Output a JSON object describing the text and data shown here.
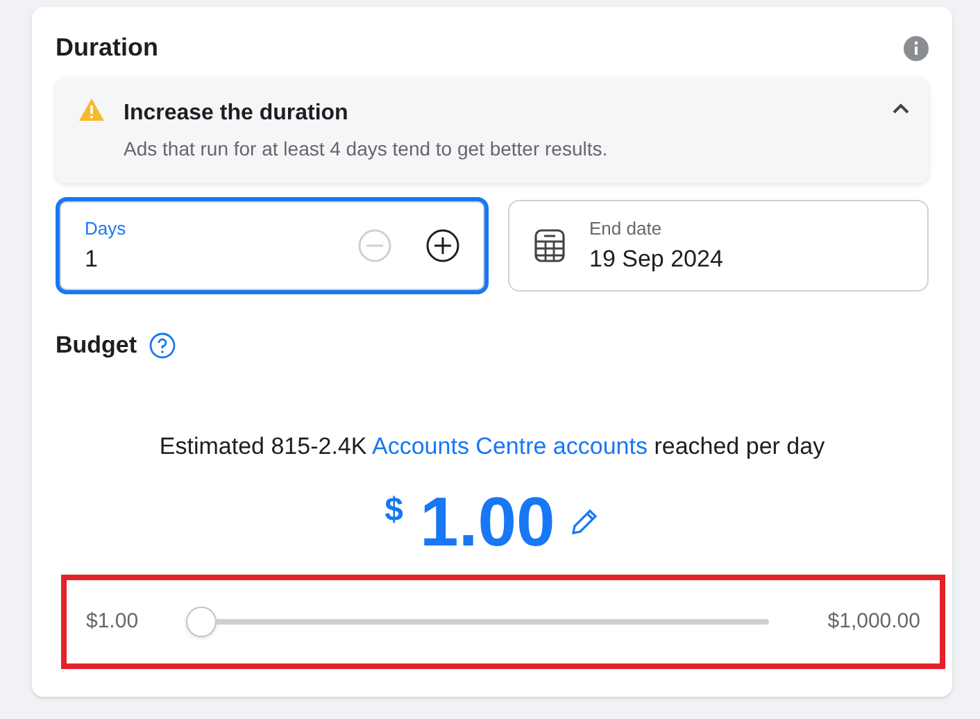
{
  "duration": {
    "title": "Duration",
    "notice": {
      "title": "Increase the duration",
      "text": "Ads that run for at least 4 days tend to get better results.",
      "expanded": true
    },
    "days": {
      "label": "Days",
      "value": "1",
      "focused": true,
      "decrement_disabled": true
    },
    "end_date": {
      "label": "End date",
      "value": "19 Sep 2024"
    }
  },
  "budget": {
    "title": "Budget",
    "estimate": {
      "before": "Estimated 815-2.4K",
      "link": "Accounts Centre accounts",
      "after": "reached per day"
    },
    "currency": "$",
    "amount": "1.00",
    "slider": {
      "min_label": "$1.00",
      "max_label": "$1,000.00",
      "level": 0
    },
    "highlighted": true
  }
}
